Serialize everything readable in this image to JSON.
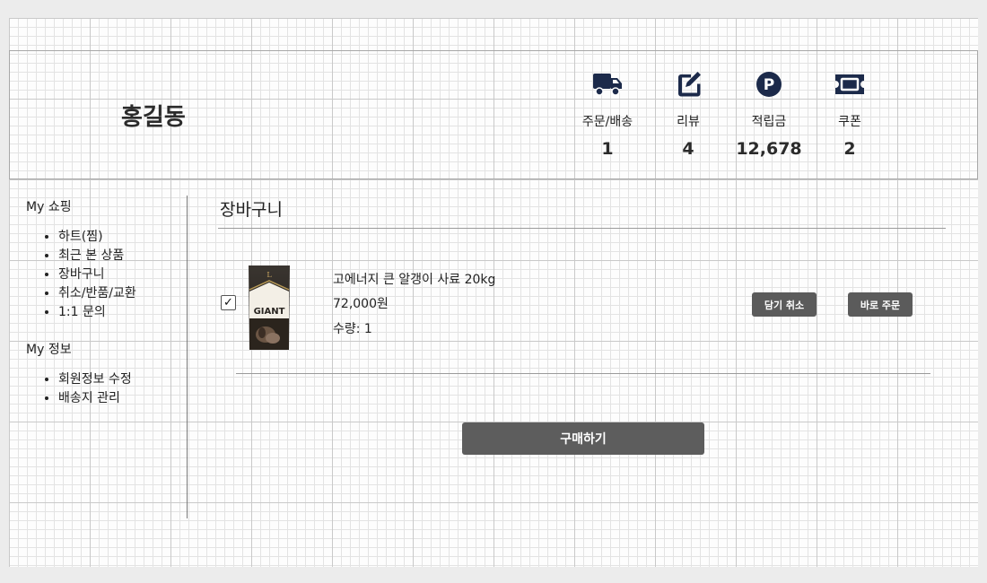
{
  "user": {
    "name": "홍길동"
  },
  "stats": [
    {
      "icon": "truck-icon",
      "label": "주문/배송",
      "value": "1"
    },
    {
      "icon": "edit-icon",
      "label": "리뷰",
      "value": "4"
    },
    {
      "icon": "point-icon",
      "label": "적립금",
      "value": "12,678"
    },
    {
      "icon": "ticket-icon",
      "label": "쿠폰",
      "value": "2"
    }
  ],
  "sidebar": {
    "shopping_title": "My 쇼핑",
    "shopping_items": [
      "하트(찜)",
      "최근 본 상품",
      "장바구니",
      "취소/반품/교환",
      "1:1 문의"
    ],
    "info_title": "My 정보",
    "info_items": [
      "회원정보 수정",
      "배송지 관리"
    ]
  },
  "cart": {
    "title": "장바구니",
    "item": {
      "checked": true,
      "image_label": "GIANT",
      "name": "고에너지 큰 알갱이 사료 20kg",
      "price": "72,000원",
      "quantity": "수량: 1",
      "cancel_label": "담기 취소",
      "order_label": "바로 주문"
    },
    "buy_label": "구매하기"
  },
  "colors": {
    "icon_navy": "#1c2a4a",
    "button_gray": "#5b5b5b"
  }
}
